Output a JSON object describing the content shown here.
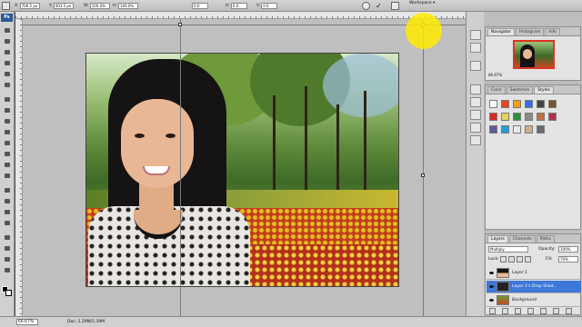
{
  "options_bar": {
    "x_label": "X:",
    "x_value": "706.5 px",
    "y_label": "Y:",
    "y_value": "403.5 px",
    "w_label": "W:",
    "w_value": "100.0%",
    "h_label": "H:",
    "h_value": "100.0%",
    "rotate_value": "0.0",
    "h_skew_label": "H:",
    "h_skew_value": "0.0",
    "v_skew_label": "V:",
    "v_skew_value": "0.0",
    "workspace_label": "Workspace ▾"
  },
  "toolbox": {
    "logo": "Ps"
  },
  "status_bar": {
    "zoom": "66.67%",
    "doc_info": "Doc: 2.29M/5.39M"
  },
  "navigator": {
    "tabs": [
      "Navigator",
      "Histogram",
      "Info"
    ],
    "zoom": "66.67%"
  },
  "swatches_panel": {
    "tabs": [
      "Color",
      "Swatches",
      "Styles"
    ],
    "swatch_colors": [
      "#ffffff",
      "#e04a1f",
      "#f2a300",
      "#3a6de0",
      "#444444",
      "#7a5230",
      "#d62d20",
      "#e8d25a",
      "#2f8f3a",
      "#8a8a8a",
      "#c07040",
      "#b03050",
      "#5a5a9a",
      "#1f9fd6",
      "#e9e9e9",
      "#d0b090",
      "#6a6a6a"
    ]
  },
  "layers_panel": {
    "tabs": [
      "Layers",
      "Channels",
      "Paths"
    ],
    "blend_mode": "Multiply",
    "opacity_label": "Opacity:",
    "opacity_value": "100%",
    "lock_label": "Lock:",
    "fill_label": "Fill:",
    "fill_value": "70%",
    "layers": [
      {
        "name": "Layer 1",
        "selected": false
      },
      {
        "name": "Layer 1's Drop Shad...",
        "selected": true
      },
      {
        "name": "Background",
        "selected": false
      }
    ]
  }
}
